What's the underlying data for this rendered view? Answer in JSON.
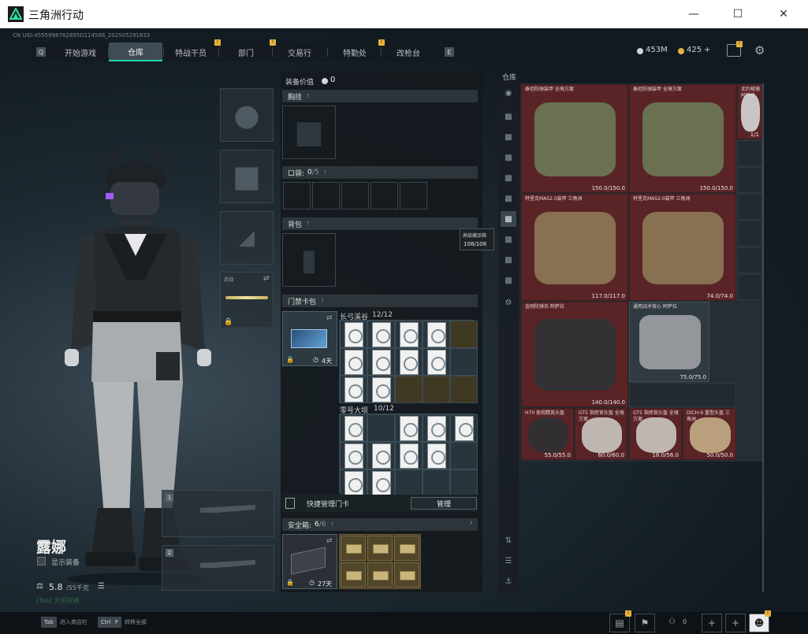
{
  "window": {
    "title": "三角洲行动"
  },
  "header": {
    "uid": "CN UID:4555998762895D114586_202505291833",
    "left_key": "Q",
    "right_key": "E",
    "tabs": [
      {
        "label": "开始游戏",
        "active": false,
        "badge": ""
      },
      {
        "label": "仓库",
        "active": true,
        "badge": ""
      },
      {
        "label": "特战干员",
        "active": false,
        "badge": "!"
      },
      {
        "label": "部门",
        "active": false,
        "badge": "!"
      },
      {
        "label": "交易行",
        "active": false,
        "badge": ""
      },
      {
        "label": "特勤处",
        "active": false,
        "badge": "!"
      },
      {
        "label": "改枪台",
        "active": false,
        "badge": ""
      }
    ],
    "currency": {
      "tickets": "453M",
      "coins": "425"
    },
    "plus": "+"
  },
  "character": {
    "name": "露娜",
    "show_equipment_label": "显示装备",
    "weight": "5.8",
    "weight_max": "/55千克",
    "status": "[Tab] 大招就绪",
    "secondary_slot_1": "1",
    "secondary_slot_2": "2",
    "melee_label": "近战"
  },
  "equipment_panel": {
    "value_label": "装备价值",
    "value": "0",
    "chest_rig_label": "胸挂",
    "pockets_label": "口袋:",
    "pockets_value": "0",
    "pockets_max": "/5",
    "backpack_label": "背包",
    "keycard_bag_label": "门禁卡包",
    "keycard_time": "4天",
    "group1_label": "长弓溪谷",
    "group1_count": "12/12",
    "group2_label": "零号大坝",
    "group2_count": "10/12",
    "quick_manage_label": "快捷管理门卡",
    "manage_button": "管理",
    "safe_box_label": "安全箱:",
    "safe_box_value": "6",
    "safe_box_max": "/6",
    "safe_box_time": "27天",
    "tooltip_title": "高级藏品箱",
    "tooltip_value": "108/108"
  },
  "stash": {
    "label": "仓库",
    "items": [
      {
        "name": "泰坦防弹装甲 全境方案",
        "dur": "150.0/150.0"
      },
      {
        "name": "泰坦防弹装甲 全境方案",
        "dur": "150.0/150.0"
      },
      {
        "name": "特里克MAS2.0装甲 三角洲",
        "dur": "117.0/117.0"
      },
      {
        "name": "特里克MAS2.0装甲 三角洲",
        "dur": "74.0/74.0"
      },
      {
        "name": "金刚防弹衣 阿萨拉",
        "dur": "140.0/140.0"
      },
      {
        "name": "通用战术背心 阿萨拉",
        "dur": "75.0/75.0"
      },
      {
        "name": "H70 夜视精英头盔",
        "dur": "55.0/55.0"
      },
      {
        "name": "GT5 指挥官头盔 全境方案",
        "dur": "60.0/60.0"
      },
      {
        "name": "GT5 指挥官头盔 全境方案",
        "dur": "18.0/56.0"
      },
      {
        "name": "DICH-9 重型头盔 三角洲",
        "dur": "50.0/50.0"
      },
      {
        "name": "北约棱镜 阿萨拉",
        "dur": "1/1"
      }
    ]
  },
  "bottom": {
    "key1": "Tab",
    "hint1": "进入商店栏",
    "key2": "Ctrl",
    "key2b": "F",
    "hint2": "转移全部",
    "friends": "0"
  }
}
